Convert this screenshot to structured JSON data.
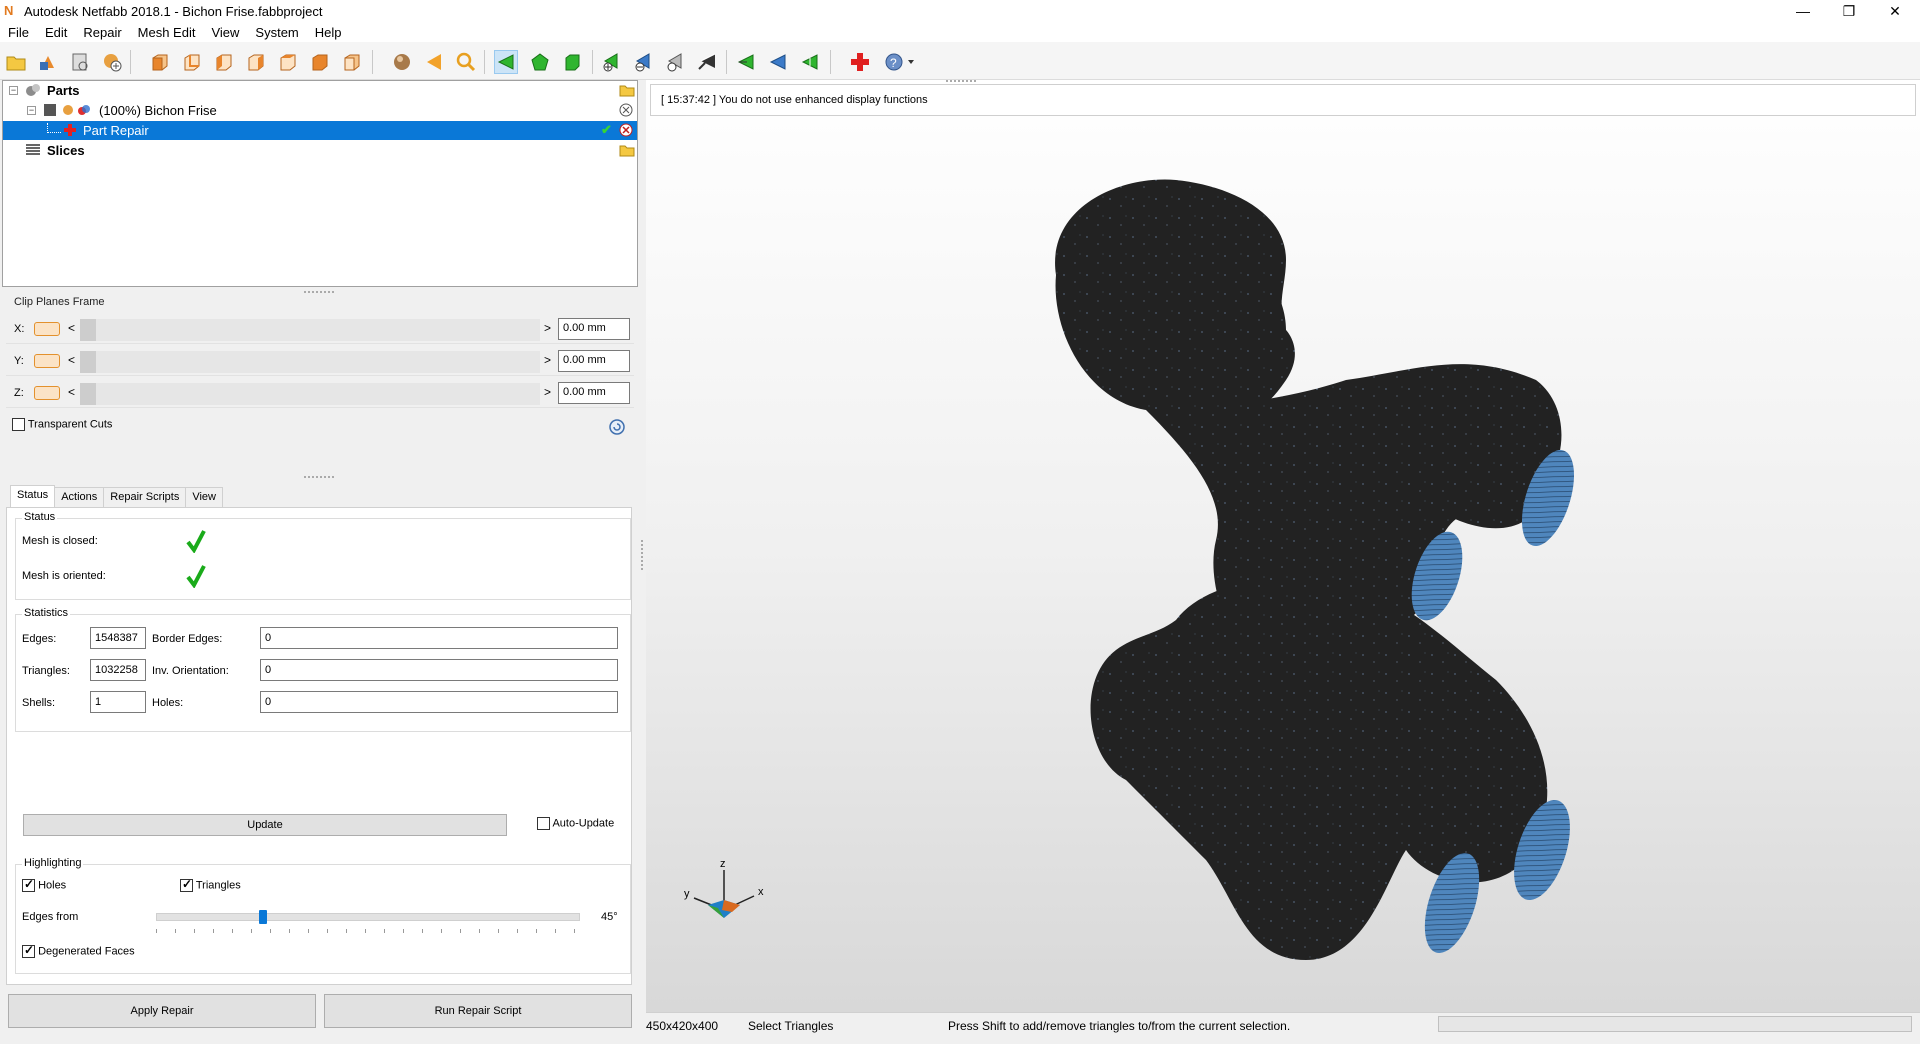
{
  "window": {
    "title": "Autodesk Netfabb 2018.1 - Bichon Frise.fabbproject",
    "app_icon": "netfabb-n-icon",
    "controls": [
      "minimize-icon",
      "restore-icon",
      "close-icon"
    ]
  },
  "menu": [
    "File",
    "Edit",
    "Repair",
    "Mesh Edit",
    "View",
    "System",
    "Help"
  ],
  "toolbar_icons": [
    "open-project-icon",
    "add-part-icon",
    "measure-icon",
    "add-icon",
    "view-front-icon",
    "view-back-icon",
    "view-left-icon",
    "view-right-icon",
    "view-top-icon",
    "view-bottom-icon",
    "view-iso-icon",
    "sphere-icon",
    "arrow-left-icon",
    "zoom-icon",
    "select-triangles-icon",
    "select-surfaces-icon",
    "select-shells-icon",
    "mark-icon",
    "unmark-icon",
    "invert-icon",
    "remove-icon",
    "select-icon",
    "deselect-icon",
    "select-all-icon",
    "repair-cross-icon",
    "help-dropdown-icon"
  ],
  "tree": {
    "parts_label": "Parts",
    "part_name": "(100%) Bichon Frise",
    "repair_label": "Part Repair",
    "slices_label": "Slices"
  },
  "clip": {
    "title": "Clip Planes Frame",
    "rows": [
      {
        "axis": "X:",
        "value": "0.00 mm"
      },
      {
        "axis": "Y:",
        "value": "0.00 mm"
      },
      {
        "axis": "Z:",
        "value": "0.00 mm"
      }
    ],
    "transparent_label": "Transparent Cuts"
  },
  "tabs": [
    "Status",
    "Actions",
    "Repair Scripts",
    "View"
  ],
  "status": {
    "title": "Status",
    "closed_label": "Mesh is closed:",
    "oriented_label": "Mesh is oriented:"
  },
  "stats": {
    "title": "Statistics",
    "edges_label": "Edges:",
    "edges": "1548387",
    "border_label": "Border Edges:",
    "border": "0",
    "triangles_label": "Triangles:",
    "triangles": "1032258",
    "inv_label": "Inv. Orientation:",
    "inv": "0",
    "shells_label": "Shells:",
    "shells": "1",
    "holes_label": "Holes:",
    "holes": "0",
    "update_label": "Update",
    "autoupdate_label": "Auto-Update"
  },
  "highlight": {
    "title": "Highlighting",
    "holes_label": "Holes",
    "triangles_label": "Triangles",
    "edges_from_label": "Edges from",
    "edges_from_value": "45°",
    "edges_from_fraction": 0.25,
    "degenerated_label": "Degenerated Faces"
  },
  "buttons": {
    "apply": "Apply Repair",
    "run_script": "Run Repair Script"
  },
  "viewport": {
    "log": "[ 15:37:42 ] You do not use enhanced display functions",
    "axis_x": "x",
    "axis_y": "y",
    "axis_z": "z"
  },
  "statusbar": {
    "dims": "450x420x400",
    "mode": "Select Triangles",
    "hint": "Press Shift to add/remove triangles to/from the current selection."
  },
  "colors": {
    "selection": "#0a78d7",
    "model": "#222222",
    "hole_fill": "#4f86bd",
    "check_green": "#1aab1a"
  }
}
